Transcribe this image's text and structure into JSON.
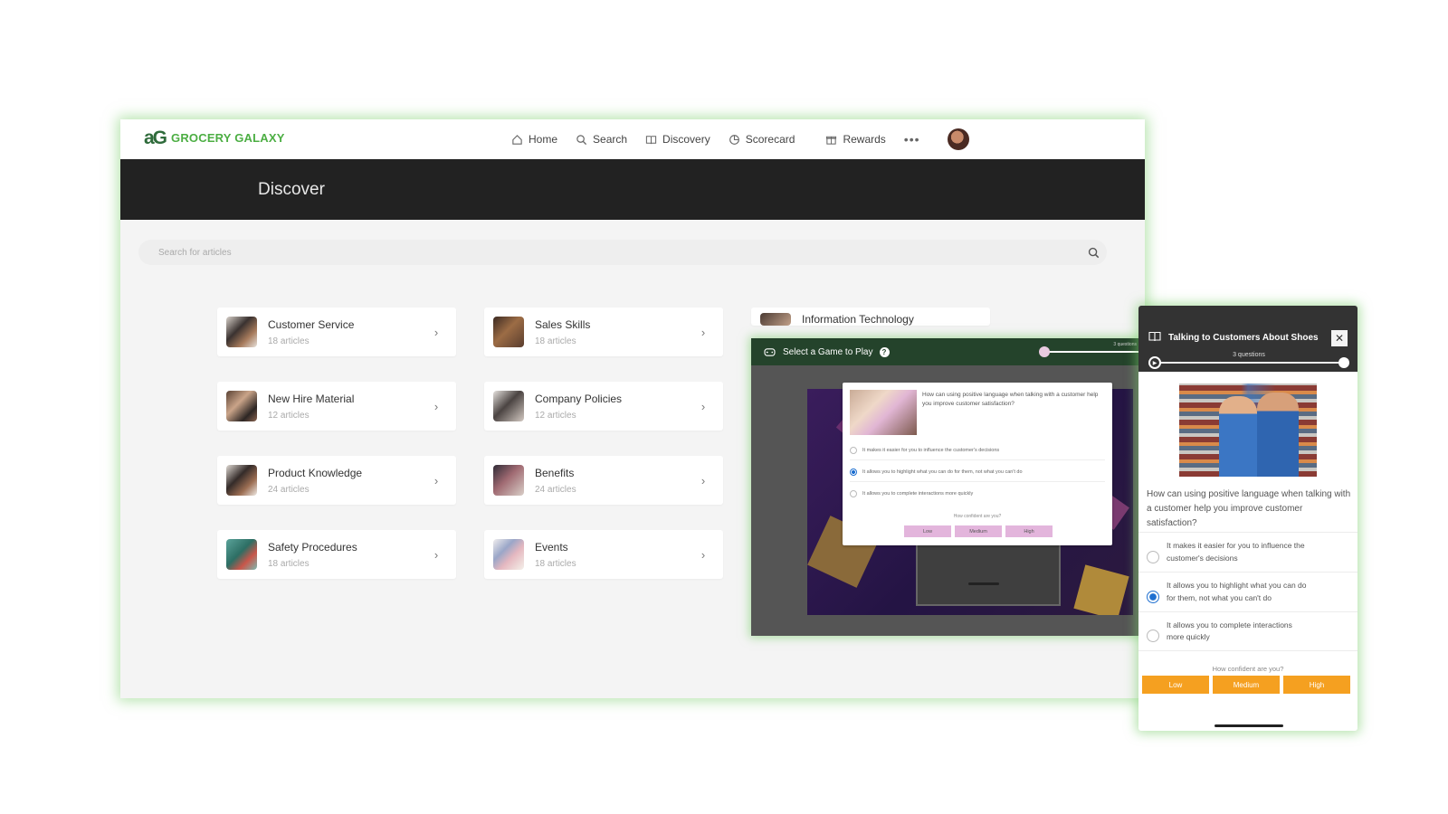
{
  "brand": {
    "logo_mark": "aG",
    "name": "GROCERY GALAXY"
  },
  "nav": {
    "items": [
      {
        "label": "Home",
        "icon": "home-icon"
      },
      {
        "label": "Search",
        "icon": "search-icon"
      },
      {
        "label": "Discovery",
        "icon": "book-icon"
      },
      {
        "label": "Scorecard",
        "icon": "chart-icon"
      },
      {
        "label": "Rewards",
        "icon": "gift-icon"
      }
    ],
    "more": "•••"
  },
  "banner": {
    "title": "Discover"
  },
  "search": {
    "placeholder": "Search for articles"
  },
  "categories": [
    {
      "title": "Customer Service",
      "count": "18 articles"
    },
    {
      "title": "Sales Skills",
      "count": "18 articles"
    },
    {
      "title": "Information Technology",
      "count": ""
    },
    {
      "title": "New Hire Material",
      "count": "12 articles"
    },
    {
      "title": "Company Policies",
      "count": "12 articles"
    },
    {
      "title": "Product Knowledge",
      "count": "24 articles"
    },
    {
      "title": "Benefits",
      "count": "24 articles"
    },
    {
      "title": "Safety Procedures",
      "count": "18 articles"
    },
    {
      "title": "Events",
      "count": "18 articles"
    }
  ],
  "game": {
    "title": "Select a Game to Play",
    "help": "?",
    "progress_label": "3 questions",
    "question": "How can using positive language when talking with a customer help you improve customer satisfaction?",
    "options": [
      "It makes it easier for you to influence the customer's decisions",
      "It allows you to highlight what you can do for them, not what you can't do",
      "It allows you to complete interactions more quickly"
    ],
    "selected_index": 1,
    "confidence_prompt": "How confident are you?",
    "confidence_levels": [
      "Low",
      "Medium",
      "High"
    ],
    "accent": "#e3b5dc"
  },
  "panel": {
    "title": "Talking to Customers About Shoes",
    "close": "✕",
    "progress_label": "3 questions",
    "question": "How can using positive language when talking with a customer help you improve customer satisfaction?",
    "options": [
      "It makes it easier for you to influence the customer's decisions",
      "It allows you to highlight what you can do for them, not what you can't do",
      "It allows you to complete interactions more quickly"
    ],
    "selected_index": 1,
    "confidence_prompt": "How confident are you?",
    "confidence_levels": [
      "Low",
      "Medium",
      "High"
    ],
    "accent": "#f5a020"
  },
  "colors": {
    "brand_green": "#4cae43",
    "glow": "#7cce6e",
    "banner": "#222222",
    "game_header": "#24432b"
  }
}
